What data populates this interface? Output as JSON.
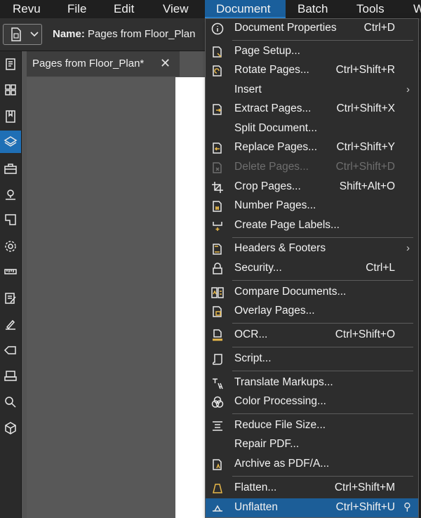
{
  "menubar": {
    "items": [
      "Revu",
      "File",
      "Edit",
      "View",
      "Document",
      "Batch",
      "Tools",
      "W"
    ],
    "active": "Document"
  },
  "toolbar": {
    "name_label": "Name:",
    "name_value": "Pages from Floor_Plan"
  },
  "tab": {
    "title": "Pages from Floor_Plan*",
    "close": "✕"
  },
  "document_menu": {
    "items": [
      {
        "label": "Document Properties",
        "shortcut": "Ctrl+D",
        "icon": "info-icon"
      },
      {
        "label": "Page Setup...",
        "shortcut": "",
        "icon": "page-setup-icon"
      },
      {
        "label": "Rotate Pages...",
        "shortcut": "Ctrl+Shift+R",
        "icon": "rotate-pages-icon"
      },
      {
        "label": "Insert",
        "shortcut": "",
        "icon": ""
      },
      {
        "label": "Extract Pages...",
        "shortcut": "Ctrl+Shift+X",
        "icon": "extract-pages-icon"
      },
      {
        "label": "Split Document...",
        "shortcut": "",
        "icon": ""
      },
      {
        "label": "Replace Pages...",
        "shortcut": "Ctrl+Shift+Y",
        "icon": "replace-pages-icon"
      },
      {
        "label": "Delete Pages...",
        "shortcut": "Ctrl+Shift+D",
        "icon": "delete-pages-icon"
      },
      {
        "label": "Crop Pages...",
        "shortcut": "Shift+Alt+O",
        "icon": "crop-icon"
      },
      {
        "label": "Number Pages...",
        "shortcut": "",
        "icon": "number-pages-icon"
      },
      {
        "label": "Create Page Labels...",
        "shortcut": "",
        "icon": "page-labels-icon"
      },
      {
        "label": "Headers & Footers",
        "shortcut": "",
        "icon": "headers-footers-icon"
      },
      {
        "label": "Security...",
        "shortcut": "Ctrl+L",
        "icon": "lock-icon"
      },
      {
        "label": "Compare Documents...",
        "shortcut": "",
        "icon": "compare-icon"
      },
      {
        "label": "Overlay Pages...",
        "shortcut": "",
        "icon": "overlay-icon"
      },
      {
        "label": "OCR...",
        "shortcut": "Ctrl+Shift+O",
        "icon": "ocr-icon"
      },
      {
        "label": "Script...",
        "shortcut": "",
        "icon": "script-icon"
      },
      {
        "label": "Translate Markups...",
        "shortcut": "",
        "icon": "translate-icon"
      },
      {
        "label": "Color Processing...",
        "shortcut": "",
        "icon": "color-processing-icon"
      },
      {
        "label": "Reduce File Size...",
        "shortcut": "",
        "icon": "reduce-size-icon"
      },
      {
        "label": "Repair PDF...",
        "shortcut": "",
        "icon": ""
      },
      {
        "label": "Archive as PDF/A...",
        "shortcut": "",
        "icon": "archive-icon"
      },
      {
        "label": "Flatten...",
        "shortcut": "Ctrl+Shift+M",
        "icon": "flatten-icon"
      },
      {
        "label": "Unflatten",
        "shortcut": "Ctrl+Shift+U",
        "icon": "unflatten-icon"
      }
    ],
    "highlighted": "Unflatten",
    "submenu_arrow": "›",
    "pin": "⚲"
  }
}
